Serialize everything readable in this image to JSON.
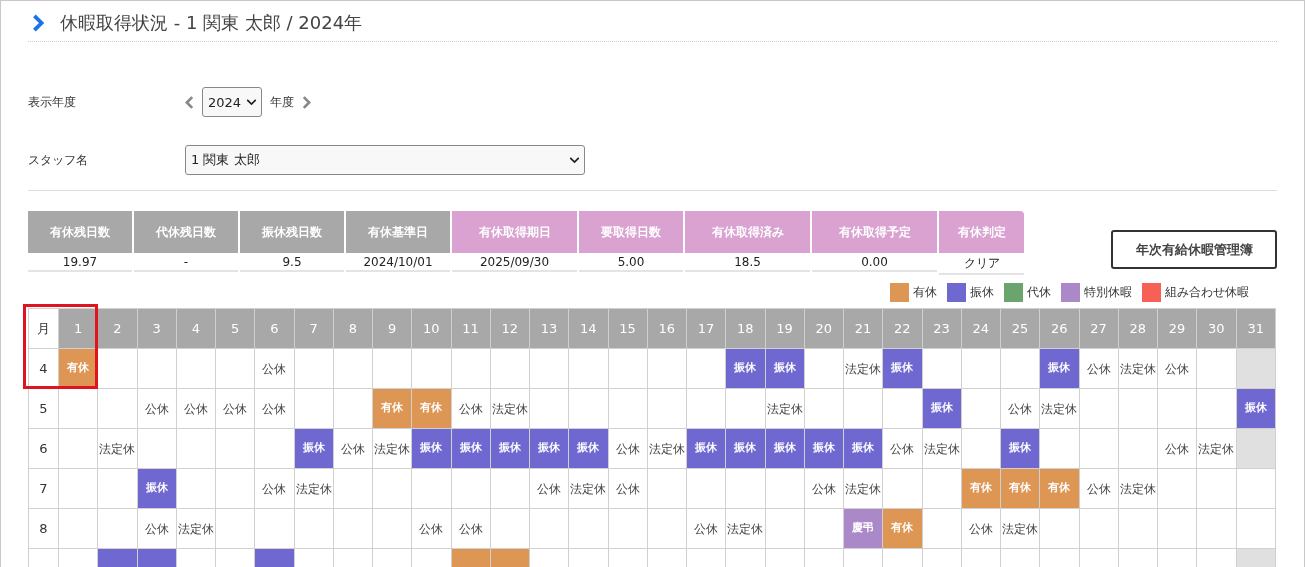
{
  "page_title": "休暇取得状況 - 1 関東 太郎 / 2024年",
  "year_filter": {
    "label": "表示年度",
    "value": "2024",
    "unit": "年度"
  },
  "staff_filter": {
    "label": "スタッフ名",
    "value": "1 関東 太郎"
  },
  "summary": [
    {
      "heading": "有休残日数",
      "value": "19.97",
      "kind": "balance"
    },
    {
      "heading": "代休残日数",
      "value": "-",
      "kind": "balance"
    },
    {
      "heading": "振休残日数",
      "value": "9.5",
      "kind": "balance"
    },
    {
      "heading": "有休基準日",
      "value": "2024/10/01",
      "kind": "balance"
    },
    {
      "heading": "有休取得期日",
      "value": "2025/09/30",
      "kind": "obligation"
    },
    {
      "heading": "要取得日数",
      "value": "5.00",
      "kind": "obligation"
    },
    {
      "heading": "有休取得済み",
      "value": "18.5",
      "kind": "obligation"
    },
    {
      "heading": "有休取得予定",
      "value": "0.00",
      "kind": "obligation"
    },
    {
      "heading": "有休判定",
      "value": "クリア",
      "kind": "obligation"
    }
  ],
  "ledger_button": "年次有給休暇管理簿",
  "legend": [
    {
      "label": "有休",
      "color": "#de9655"
    },
    {
      "label": "振休",
      "color": "#6f68d0"
    },
    {
      "label": "代休",
      "color": "#6aa56d"
    },
    {
      "label": "特別休暇",
      "color": "#ab88c8"
    },
    {
      "label": "組み合わせ休暇",
      "color": "#f76155"
    }
  ],
  "calendar": {
    "corner": "月",
    "highlight_first_cell": true,
    "days": [
      "1",
      "2",
      "3",
      "4",
      "5",
      "6",
      "7",
      "8",
      "9",
      "10",
      "11",
      "12",
      "13",
      "14",
      "15",
      "16",
      "17",
      "18",
      "19",
      "20",
      "21",
      "22",
      "23",
      "24",
      "25",
      "26",
      "27",
      "28",
      "29",
      "30",
      "31"
    ],
    "rows": [
      {
        "month": "4",
        "cells": [
          {
            "kind": "paid",
            "text": "有休"
          },
          {
            "kind": "empty"
          },
          {
            "kind": "empty"
          },
          {
            "kind": "empty"
          },
          {
            "kind": "empty"
          },
          {
            "kind": "off",
            "text": "公休"
          },
          {
            "kind": "empty"
          },
          {
            "kind": "empty"
          },
          {
            "kind": "empty"
          },
          {
            "kind": "empty"
          },
          {
            "kind": "empty"
          },
          {
            "kind": "empty"
          },
          {
            "kind": "empty"
          },
          {
            "kind": "empty"
          },
          {
            "kind": "empty"
          },
          {
            "kind": "empty"
          },
          {
            "kind": "empty"
          },
          {
            "kind": "transfer",
            "text": "振休"
          },
          {
            "kind": "transfer",
            "text": "振休"
          },
          {
            "kind": "empty"
          },
          {
            "kind": "off",
            "text": "法定休"
          },
          {
            "kind": "transfer",
            "text": "振休"
          },
          {
            "kind": "empty"
          },
          {
            "kind": "empty"
          },
          {
            "kind": "empty"
          },
          {
            "kind": "transfer",
            "text": "振休"
          },
          {
            "kind": "off",
            "text": "公休"
          },
          {
            "kind": "off",
            "text": "法定休"
          },
          {
            "kind": "off",
            "text": "公休"
          },
          {
            "kind": "empty"
          },
          {
            "kind": "invalid"
          }
        ]
      },
      {
        "month": "5",
        "cells": [
          {
            "kind": "empty"
          },
          {
            "kind": "empty"
          },
          {
            "kind": "off",
            "text": "公休"
          },
          {
            "kind": "off",
            "text": "公休"
          },
          {
            "kind": "off",
            "text": "公休"
          },
          {
            "kind": "off",
            "text": "公休"
          },
          {
            "kind": "empty"
          },
          {
            "kind": "empty"
          },
          {
            "kind": "paid",
            "text": "有休"
          },
          {
            "kind": "paid",
            "text": "有休"
          },
          {
            "kind": "off",
            "text": "公休"
          },
          {
            "kind": "off",
            "text": "法定休"
          },
          {
            "kind": "empty"
          },
          {
            "kind": "empty"
          },
          {
            "kind": "empty"
          },
          {
            "kind": "empty"
          },
          {
            "kind": "empty"
          },
          {
            "kind": "empty"
          },
          {
            "kind": "off",
            "text": "法定休"
          },
          {
            "kind": "empty"
          },
          {
            "kind": "empty"
          },
          {
            "kind": "empty"
          },
          {
            "kind": "transfer",
            "text": "振休"
          },
          {
            "kind": "empty"
          },
          {
            "kind": "off",
            "text": "公休"
          },
          {
            "kind": "off",
            "text": "法定休"
          },
          {
            "kind": "empty"
          },
          {
            "kind": "empty"
          },
          {
            "kind": "empty"
          },
          {
            "kind": "empty"
          },
          {
            "kind": "transfer",
            "text": "振休"
          }
        ]
      },
      {
        "month": "6",
        "cells": [
          {
            "kind": "empty"
          },
          {
            "kind": "off",
            "text": "法定休"
          },
          {
            "kind": "empty"
          },
          {
            "kind": "empty"
          },
          {
            "kind": "empty"
          },
          {
            "kind": "empty"
          },
          {
            "kind": "transfer",
            "text": "振休"
          },
          {
            "kind": "off",
            "text": "公休"
          },
          {
            "kind": "off",
            "text": "法定休"
          },
          {
            "kind": "transfer",
            "text": "振休"
          },
          {
            "kind": "transfer",
            "text": "振休"
          },
          {
            "kind": "transfer",
            "text": "振休"
          },
          {
            "kind": "transfer",
            "text": "振休"
          },
          {
            "kind": "transfer",
            "text": "振休"
          },
          {
            "kind": "off",
            "text": "公休"
          },
          {
            "kind": "off",
            "text": "法定休"
          },
          {
            "kind": "transfer",
            "text": "振休"
          },
          {
            "kind": "transfer",
            "text": "振休"
          },
          {
            "kind": "transfer",
            "text": "振休"
          },
          {
            "kind": "transfer",
            "text": "振休"
          },
          {
            "kind": "transfer",
            "text": "振休"
          },
          {
            "kind": "off",
            "text": "公休"
          },
          {
            "kind": "off",
            "text": "法定休"
          },
          {
            "kind": "empty"
          },
          {
            "kind": "transfer",
            "text": "振休"
          },
          {
            "kind": "empty"
          },
          {
            "kind": "empty"
          },
          {
            "kind": "empty"
          },
          {
            "kind": "off",
            "text": "公休"
          },
          {
            "kind": "off",
            "text": "法定休"
          },
          {
            "kind": "invalid"
          }
        ]
      },
      {
        "month": "7",
        "cells": [
          {
            "kind": "empty"
          },
          {
            "kind": "empty"
          },
          {
            "kind": "transfer",
            "text": "振休"
          },
          {
            "kind": "empty"
          },
          {
            "kind": "empty"
          },
          {
            "kind": "off",
            "text": "公休"
          },
          {
            "kind": "off",
            "text": "法定休"
          },
          {
            "kind": "empty"
          },
          {
            "kind": "empty"
          },
          {
            "kind": "empty"
          },
          {
            "kind": "empty"
          },
          {
            "kind": "empty"
          },
          {
            "kind": "off",
            "text": "公休"
          },
          {
            "kind": "off",
            "text": "法定休"
          },
          {
            "kind": "off",
            "text": "公休"
          },
          {
            "kind": "empty"
          },
          {
            "kind": "empty"
          },
          {
            "kind": "empty"
          },
          {
            "kind": "empty"
          },
          {
            "kind": "off",
            "text": "公休"
          },
          {
            "kind": "off",
            "text": "法定休"
          },
          {
            "kind": "empty"
          },
          {
            "kind": "empty"
          },
          {
            "kind": "paid",
            "text": "有休"
          },
          {
            "kind": "paid",
            "text": "有休"
          },
          {
            "kind": "paid",
            "text": "有休"
          },
          {
            "kind": "off",
            "text": "公休"
          },
          {
            "kind": "off",
            "text": "法定休"
          },
          {
            "kind": "empty"
          },
          {
            "kind": "empty"
          },
          {
            "kind": "empty"
          }
        ]
      },
      {
        "month": "8",
        "cells": [
          {
            "kind": "empty"
          },
          {
            "kind": "empty"
          },
          {
            "kind": "off",
            "text": "公休"
          },
          {
            "kind": "off",
            "text": "法定休"
          },
          {
            "kind": "empty"
          },
          {
            "kind": "empty"
          },
          {
            "kind": "empty"
          },
          {
            "kind": "empty"
          },
          {
            "kind": "empty"
          },
          {
            "kind": "off",
            "text": "公休"
          },
          {
            "kind": "off",
            "text": "公休"
          },
          {
            "kind": "empty"
          },
          {
            "kind": "empty"
          },
          {
            "kind": "empty"
          },
          {
            "kind": "empty"
          },
          {
            "kind": "empty"
          },
          {
            "kind": "off",
            "text": "公休"
          },
          {
            "kind": "off",
            "text": "法定休"
          },
          {
            "kind": "empty"
          },
          {
            "kind": "empty"
          },
          {
            "kind": "special",
            "text": "慶弔"
          },
          {
            "kind": "paid",
            "text": "有休"
          },
          {
            "kind": "empty"
          },
          {
            "kind": "off",
            "text": "公休"
          },
          {
            "kind": "off",
            "text": "法定休"
          },
          {
            "kind": "empty"
          },
          {
            "kind": "empty"
          },
          {
            "kind": "empty"
          },
          {
            "kind": "empty"
          },
          {
            "kind": "empty"
          },
          {
            "kind": "empty"
          }
        ]
      },
      {
        "cells": [
          {
            "kind": "empty"
          },
          {
            "kind": "transfer"
          },
          {
            "kind": "transfer"
          },
          {
            "kind": "empty"
          },
          {
            "kind": "empty"
          },
          {
            "kind": "transfer"
          },
          {
            "kind": "empty"
          },
          {
            "kind": "empty"
          },
          {
            "kind": "empty"
          },
          {
            "kind": "empty"
          },
          {
            "kind": "paid"
          },
          {
            "kind": "paid"
          },
          {
            "kind": "empty"
          },
          {
            "kind": "empty"
          },
          {
            "kind": "empty"
          },
          {
            "kind": "empty"
          },
          {
            "kind": "empty"
          },
          {
            "kind": "empty"
          },
          {
            "kind": "empty"
          },
          {
            "kind": "empty"
          },
          {
            "kind": "empty"
          },
          {
            "kind": "empty"
          },
          {
            "kind": "empty"
          },
          {
            "kind": "empty"
          },
          {
            "kind": "empty"
          },
          {
            "kind": "empty"
          },
          {
            "kind": "empty"
          },
          {
            "kind": "empty"
          },
          {
            "kind": "empty"
          },
          {
            "kind": "empty"
          },
          {
            "kind": "invalid"
          }
        ]
      }
    ]
  }
}
